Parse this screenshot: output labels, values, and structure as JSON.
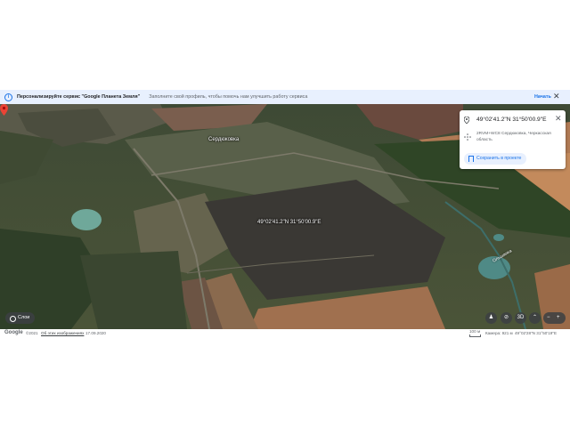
{
  "banner": {
    "title": "Персонализируйте сервис \"Google Планета Земля\"",
    "subtitle": "Заполните свой профиль, чтобы помочь нам улучшить работу сервиса",
    "start_label": "Начать",
    "close_label": "✕"
  },
  "map": {
    "village_label": "Сердюковка",
    "point_label": "49°02'41.2\"N 31°50'00.9\"E",
    "river_label": "Ольшанка"
  },
  "card": {
    "coordinates": "49°02'41.2\"N 31°50'00.9\"E",
    "plus_code_line1": "2RVM+WC8 Сердюковка, Черкасская",
    "plus_code_line2": "область",
    "save_label": "Сохранить в проекте",
    "close_label": "✕"
  },
  "controls": {
    "step_label": "Слои",
    "view_label": "3D",
    "zoom_out": "−",
    "zoom_in": "+"
  },
  "status": {
    "logo": "Google",
    "copyright": "©2021",
    "imagery_link": "Об этих изображениях",
    "imagery_date": "17.09.2020",
    "scale": "100 м",
    "camera": "Камера: 921 м",
    "position": "49°02'28\"N 31°50'19\"E"
  }
}
